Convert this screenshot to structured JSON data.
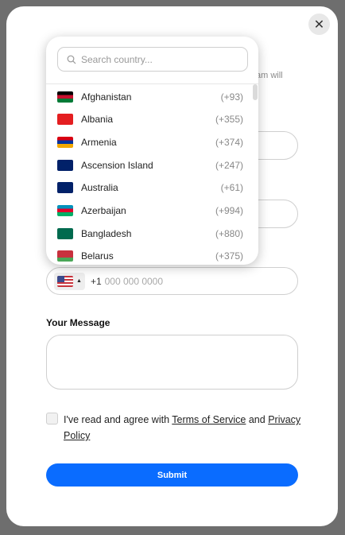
{
  "modal": {
    "close_icon": "✕",
    "subtext_fragment": "am will"
  },
  "phone": {
    "selected_flag": "US",
    "dial_code": "+1",
    "placeholder": "000 000 0000"
  },
  "message": {
    "label": "Your Message"
  },
  "agreement": {
    "prefix": "I've read and agree with ",
    "terms_label": "Terms of Service",
    "and": " and ",
    "privacy_label": "Privacy Policy"
  },
  "submit_label": "Submit",
  "dropdown": {
    "search_placeholder": "Search country...",
    "countries": [
      {
        "name": "Afghanistan",
        "code": "(+93)",
        "flag_colors": [
          "#000000",
          "#c8102e",
          "#007a36"
        ]
      },
      {
        "name": "Albania",
        "code": "(+355)",
        "flag_colors": [
          "#e41e20",
          "#e41e20",
          "#e41e20"
        ]
      },
      {
        "name": "Armenia",
        "code": "(+374)",
        "flag_colors": [
          "#d90012",
          "#0033a0",
          "#f2a800"
        ]
      },
      {
        "name": "Ascension Island",
        "code": "(+247)",
        "flag_colors": [
          "#012169",
          "#012169",
          "#012169"
        ]
      },
      {
        "name": "Australia",
        "code": "(+61)",
        "flag_colors": [
          "#012169",
          "#012169",
          "#012169"
        ]
      },
      {
        "name": "Azerbaijan",
        "code": "(+994)",
        "flag_colors": [
          "#0092bc",
          "#e4002b",
          "#00af66"
        ]
      },
      {
        "name": "Bangladesh",
        "code": "(+880)",
        "flag_colors": [
          "#006a4e",
          "#006a4e",
          "#006a4e"
        ]
      },
      {
        "name": "Belarus",
        "code": "(+375)",
        "flag_colors": [
          "#c8313e",
          "#c8313e",
          "#4aa657"
        ]
      }
    ]
  },
  "colors": {
    "accent": "#0a6cff",
    "backdrop": "#6e6e6e"
  }
}
